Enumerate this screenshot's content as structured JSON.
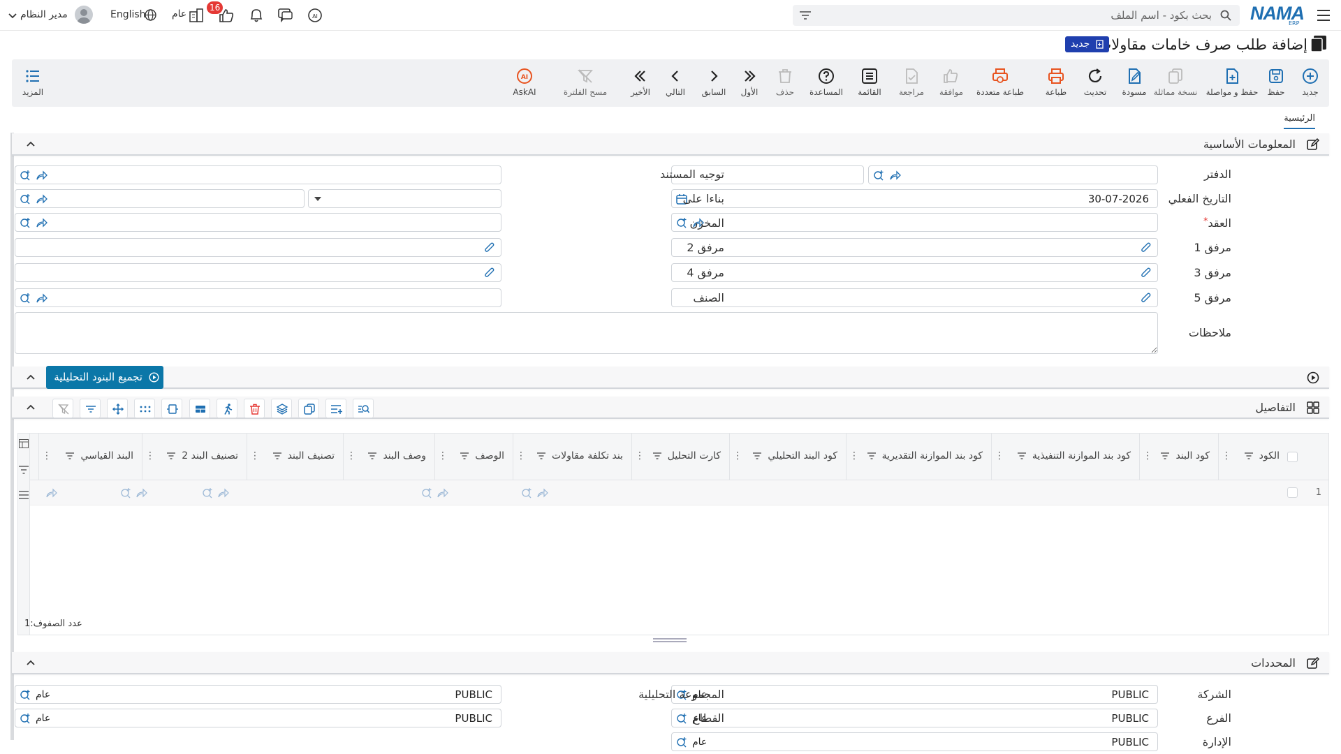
{
  "topbar": {
    "search_placeholder": "بحث بكود - اسم الملف",
    "logo_text": "NAMA",
    "logo_sub": "ERP",
    "user_label": "مدير النظام",
    "language": "English",
    "public_label": "عام",
    "notifications_count": "16"
  },
  "title": {
    "text": "إضافة طلب صرف خامات مقاولات",
    "badge": "جديد"
  },
  "toolbar": {
    "new": "جديد",
    "save": "حفظ",
    "save_continue": "حفظ و مواصلة",
    "duplicate": "نسخة مماثلة",
    "draft": "مسودة",
    "refresh": "تحديث",
    "print": "طباعة",
    "multi_print": "طباعة متعددة",
    "approve": "موافقة",
    "review": "مراجعة",
    "list": "القائمة",
    "help": "المساعدة",
    "delete": "حذف",
    "first": "الأول",
    "previous": "السابق",
    "next": "التالي",
    "last": "الأخير",
    "clear_filter": "مسح الفلترة",
    "askai": "AskAI",
    "more": "المزيد"
  },
  "tabs": {
    "main": "الرئيسية"
  },
  "basic_info": {
    "title": "المعلومات الأساسية",
    "book_label": "الدفتر",
    "doc_direction_label": "توجيه المستند",
    "actual_date_label": "التاريخ الفعلي",
    "actual_date_value": "30-07-2026",
    "based_on_label": "بناءا على",
    "contract_label": "العقد",
    "required_mark": "*",
    "warehouse_label": "المخزن",
    "attachment1_label": "مرفق 1",
    "attachment2_label": "مرفق 2",
    "attachment3_label": "مرفق 3",
    "attachment4_label": "مرفق 4",
    "attachment5_label": "مرفق 5",
    "category_label": "الصنف",
    "notes_label": "ملاحظات"
  },
  "aggregate_button": "تجميع البنود التحليلية",
  "details": {
    "title": "التفاصيل",
    "columns": [
      "الكود",
      "كود البند",
      "كود بند الموازنة التنفيذية",
      "كود بند الموازنة التقديرية",
      "كود البند التحليلي",
      "كارت التحليل",
      "بند تكلفة مقاولات",
      "الوصف",
      "وصف البند",
      "تصنيف البند",
      "تصنيف البند 2",
      "البند القياسي"
    ],
    "row_number": "1",
    "row_count_label": "عدد الصفوف:",
    "row_count_value": "1"
  },
  "determinants": {
    "title": "المحددات",
    "company_label": "الشركة",
    "company_value": "PUBLIC",
    "company_tag": "عام",
    "branch_label": "الفرع",
    "branch_value": "PUBLIC",
    "branch_tag": "عام",
    "department_label": "الإدارة",
    "department_value": "PUBLIC",
    "department_tag": "عام",
    "analytic_group_label": "المجموعة التحليلية",
    "analytic_group_value": "PUBLIC",
    "analytic_group_tag": "عام",
    "sector_label": "القطاع",
    "sector_value": "PUBLIC",
    "sector_tag": "عام"
  },
  "colors": {
    "brand": "#1f6fb2",
    "badge": "#1f3fae",
    "accent_button": "#0b77a8",
    "print_orange": "#e8531f",
    "notification_red": "#e53935"
  }
}
